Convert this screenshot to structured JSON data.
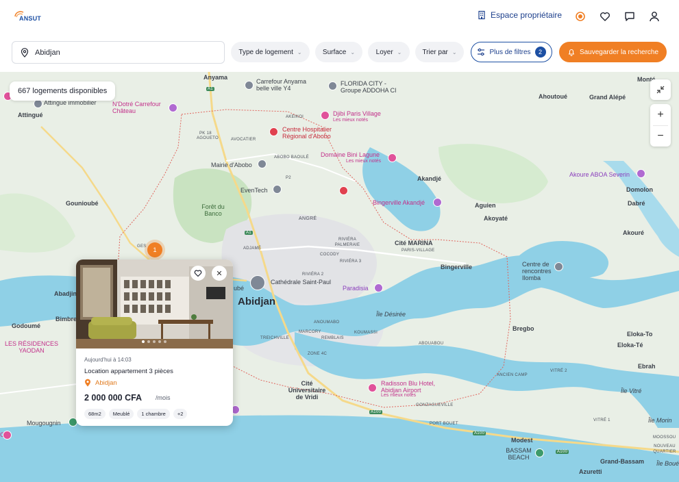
{
  "header": {
    "logo_text": "ANSUT",
    "logo_sub": "",
    "owner_label": "Espace propriétaire",
    "icons": [
      "building-icon",
      "notification-icon",
      "heart-icon",
      "chat-icon",
      "user-icon"
    ]
  },
  "filters": {
    "search_value": "Abidjan",
    "type_label": "Type de logement",
    "surface_label": "Surface",
    "rent_label": "Loyer",
    "sort_label": "Trier par",
    "more_label": "Plus de filtres",
    "more_count": "2",
    "save_label": "Sauvegarder la recherche"
  },
  "map": {
    "count_label": "667 logements disponibles",
    "cluster_count": "1",
    "zoom_in": "+",
    "zoom_out": "−",
    "labels": {
      "anyama": "Anyama",
      "carrefour": "Carrefour Anyama belle ville Y4",
      "florida": "FLORIDA CITY - Groupe ADDOHA CI",
      "attingue_immo": "Attingue immobilier",
      "ndotre": "N'Dotré Carrefour Château",
      "attingue": "Attingué",
      "akeikoi": "AKEIKOI",
      "djibi": "Djibi Paris Village",
      "mieux1": "Les mieux notés",
      "chra_line1": "Centre Hospitalier",
      "chra_line2": "Régional d'Abobo",
      "pk18": "PK 18",
      "agouéto": "AGOUETO",
      "avocatier": "AVOCATIER",
      "abobo_baoule": "ABOBO BAOULÉ",
      "domaine": "Domaine Bini Lagune",
      "mieux2": "Les mieux notés",
      "mairie": "Mairie d'Abobo",
      "eventech": "EvenTech",
      "foret": "Forêt du Banco",
      "gouniobe": "Gounioubé",
      "angre": "ANGRÉ",
      "bingerville_ak": "Bingerville Akandjé",
      "akandje": "Akandjé",
      "aguien": "Aguien",
      "akoyate": "Akoyaté",
      "ahoutoue": "Ahoutoué",
      "grand_alepe": "Grand Alépé",
      "monte": "Monté",
      "akoure_aboa": "Akoure ABOA Severin",
      "domolon": "Domolon",
      "dabre": "Dabré",
      "akoure": "Akouré",
      "adjame": "ADJAMÉ",
      "riviera_palm": "RIVIÉRA PALMERAIE",
      "cite_marina": "Cité MARINA",
      "paris_village": "PARIS-VILLAGE",
      "cocody": "COCODY",
      "riviera3": "RIVIÉRA 3",
      "bingerville": "Bingerville",
      "centre_renc": "Centre de rencontres Ilomba",
      "riviera2": "RIVIÉRA 2",
      "cathedrale": "Cathédrale Saint-Paul",
      "paradisia": "Paradisia",
      "abidjan": "Abidjan",
      "abadjin": "Abadjin",
      "bimbre": "Bimbre",
      "ile_desiree": "Île Désirée",
      "anoumabo": "ANOUMABO",
      "marcory": "MARCORY",
      "koumassi": "KOUMASSI",
      "treichville": "TREICHVILLE",
      "remblais": "REMBLAIS",
      "abouabou": "ABOUABOU",
      "bregbo": "Bregbo",
      "eloka_to": "Eloka-To",
      "eloka_te": "Eloka-Té",
      "ebrah": "Ebrah",
      "godoume": "Godoumé",
      "residences": "LES RÉSIDENCES YAODAN",
      "zone4": "ZONE 4C",
      "cite_univ": "Cité Universitaire de Vridi",
      "radisson": "Radisson Blu Hotel, Abidjan Airport",
      "mieux3": "Les mieux notés",
      "ancien_camp": "ANCIEN CAMP",
      "vitre2": "VITRÉ 2",
      "ile_vitre": "Île Vitré",
      "gonzagueville": "GONZAGUEVILLE",
      "mougougnin": "Mougougnin",
      "port_bouet": "PORT BOUET",
      "vitre1": "VITRÉ 1",
      "ile_morin": "Île Morin",
      "modest": "Modest",
      "moossou": "MOOSSOU",
      "nouveau_q": "NOUVEAU QUARTIER",
      "bassam": "BASSAM BEACH",
      "grand_bassam": "Grand-Bassam",
      "ile_boue": "Île Boué",
      "azuretti": "Azuretti",
      "a100a": "A100",
      "a100b": "A100",
      "a100c": "A100",
      "a1a": "A1",
      "a1b": "A1",
      "p2": "P2",
      "gesc": "GES",
      "ch": "CH",
      "lube": "ubé"
    }
  },
  "listing": {
    "date": "Aujourd'hui à 14:03",
    "title": "Location appartement 3 pièces",
    "location": "Abidjan",
    "price": "2 000 000 CFA",
    "period": "/mois",
    "tags": [
      "68m2",
      "Meublé",
      "1 chambre",
      "+2"
    ]
  },
  "colors": {
    "brand_blue": "#1c4fa3",
    "accent_orange": "#f07f24",
    "map_land": "#e9efe6",
    "map_water": "#8fd0e6"
  }
}
